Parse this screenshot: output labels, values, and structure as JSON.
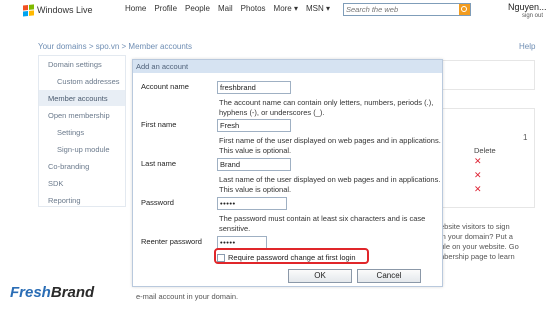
{
  "header": {
    "logo_text": "Windows Live",
    "nav": [
      "Home",
      "Profile",
      "People",
      "Mail",
      "Photos",
      "More ▾",
      "MSN ▾"
    ],
    "search_placeholder": "Search the web",
    "user_name": "Nguyen",
    "sign_out": "sign out"
  },
  "breadcrumb": "Your domains > spo.vn > Member accounts",
  "help": "Help",
  "sidebar": {
    "items": [
      {
        "label": "Domain settings"
      },
      {
        "label": "Custom addresses"
      },
      {
        "label": "Member accounts"
      },
      {
        "label": "Open membership"
      },
      {
        "label": "Settings"
      },
      {
        "label": "Sign-up module"
      },
      {
        "label": "Co-branding"
      },
      {
        "label": "SDK"
      },
      {
        "label": "Reporting"
      }
    ]
  },
  "background": {
    "page_number": "1",
    "delete_header": "Delete",
    "promo_lines": [
      "ebsite visitors to sign",
      "in your domain? Put a",
      "ule on your website. Go",
      "nbership page to learn"
    ],
    "bottom_text": "e-mail account in your domain."
  },
  "dialog": {
    "title": "Add an account",
    "account_name_label": "Account name",
    "account_name_value": "freshbrand",
    "account_name_help": "The account name can contain only letters, numbers, periods (.), hyphens (-), or underscores (_).",
    "first_name_label": "First name",
    "first_name_value": "Fresh",
    "first_name_help": "First name of the user displayed on web pages and in applications. This value is optional.",
    "last_name_label": "Last name",
    "last_name_value": "Brand",
    "last_name_help": "Last name of the user displayed on web pages and in applications. This value is optional.",
    "password_label": "Password",
    "password_value": "•••••",
    "password_help": "The password must contain at least six characters and is case sensitive.",
    "reenter_label": "Reenter password",
    "reenter_value": "•••••",
    "require_change_label": "Require password change at first login",
    "require_change_checked": false,
    "ok_label": "OK",
    "cancel_label": "Cancel"
  },
  "brand": {
    "part1": "Fresh",
    "part2": "Brand",
    "color1": "#2a6db5",
    "color2": "#2a2a2a"
  },
  "colors": {
    "highlight": "#e0262a",
    "flag_red": "#f25022",
    "flag_green": "#7fba00",
    "flag_blue": "#00a4ef",
    "flag_yellow": "#ffb900"
  }
}
